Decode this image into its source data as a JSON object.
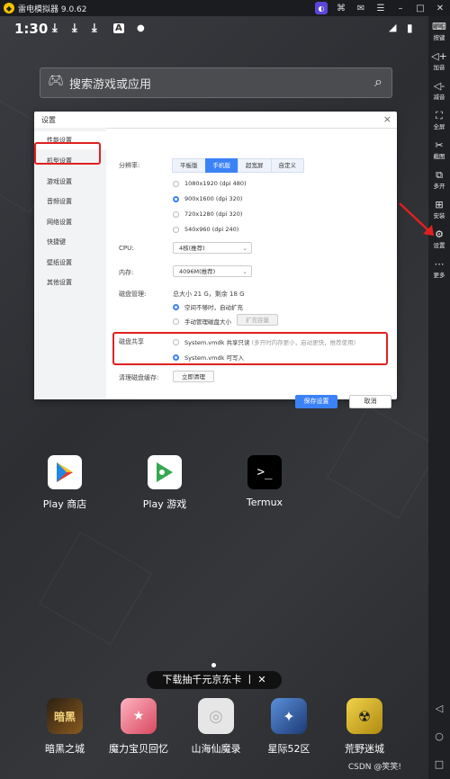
{
  "window": {
    "title": "雷电模拟器 9.0.62"
  },
  "status_bar": {
    "time": "1:30"
  },
  "search": {
    "placeholder": "搜索游戏或应用"
  },
  "sidebar": {
    "items": [
      {
        "label": "按键",
        "icon": "keyboard-icon"
      },
      {
        "label": "加音",
        "icon": "volume-up-icon"
      },
      {
        "label": "减音",
        "icon": "volume-down-icon"
      },
      {
        "label": "全屏",
        "icon": "fullscreen-icon"
      },
      {
        "label": "截图",
        "icon": "scissors-icon"
      },
      {
        "label": "多开",
        "icon": "multi-instance-icon"
      },
      {
        "label": "安装",
        "icon": "install-icon"
      },
      {
        "label": "设置",
        "icon": "gear-icon"
      },
      {
        "label": "更多",
        "icon": "more-icon"
      }
    ]
  },
  "dialog": {
    "title": "设置",
    "nav": [
      "性能设置",
      "机型设置",
      "游戏设置",
      "音频设置",
      "网络设置",
      "快捷键",
      "壁纸设置",
      "其他设置"
    ],
    "resolution": {
      "label": "分辨率:",
      "tabs": [
        "平板版",
        "手机版",
        "超宽屏",
        "自定义"
      ],
      "options": [
        "1080x1920 (dpi 480)",
        "900x1600 (dpi 320)",
        "720x1280 (dpi 320)",
        "540x960 (dpi 240)"
      ]
    },
    "cpu": {
      "label": "CPU:",
      "value": "4核(推荐)"
    },
    "memory": {
      "label": "内存:",
      "value": "4096M(推荐)"
    },
    "disk": {
      "label": "磁盘管理:",
      "info": "总大小 21 G，剩余 18 G",
      "opt_auto": "空间不够时，自动扩充",
      "opt_manual": "手动管理磁盘大小",
      "expand_button": "扩充容量"
    },
    "disk_share": {
      "label": "磁盘共享",
      "opt_readonly": "System.vmdk 共享只读",
      "opt_readonly_hint": "(多开时内存更小，启动更快，推荐使用)",
      "opt_writable": "System.vmdk 可写入"
    },
    "cache": {
      "label": "清理磁盘缓存:",
      "button": "立即清理"
    },
    "save_button": "保存设置",
    "cancel_button": "取消"
  },
  "apps": [
    {
      "label": "Play 商店"
    },
    {
      "label": "Play 游戏"
    },
    {
      "label": "Termux"
    }
  ],
  "banner": {
    "text": "下载抽千元京东卡 丨 ✕"
  },
  "dock": [
    {
      "label": "暗黑之城"
    },
    {
      "label": "魔力宝贝回忆"
    },
    {
      "label": "山海仙魔录"
    },
    {
      "label": "星际52区"
    },
    {
      "label": "荒野迷城"
    }
  ],
  "watermark": "CSDN @笑笑!"
}
